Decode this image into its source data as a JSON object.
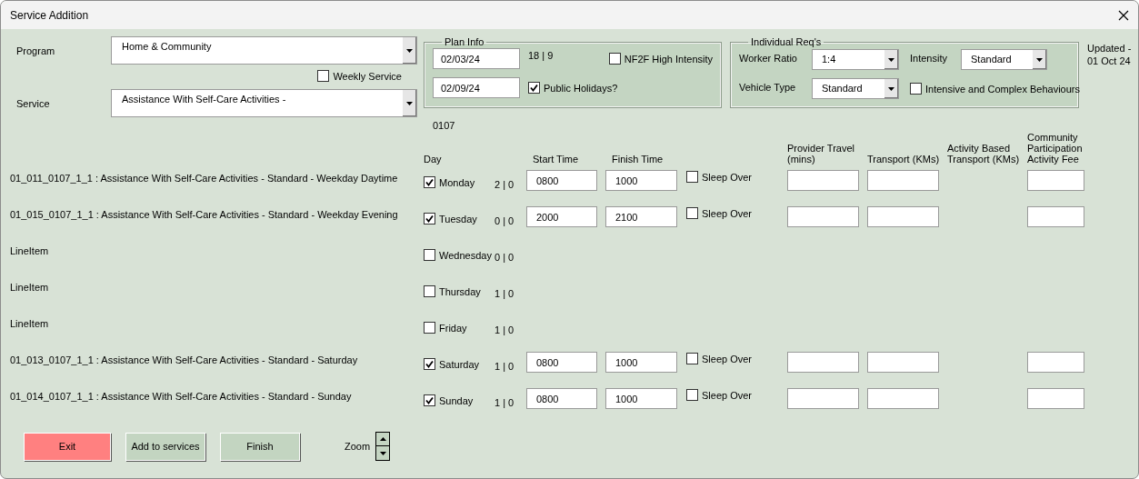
{
  "window": {
    "title": "Service Addition"
  },
  "program": {
    "label": "Program",
    "value": "Home & Community"
  },
  "weekly_service": {
    "label": "Weekly Service",
    "checked": false
  },
  "service": {
    "label": "Service",
    "value": "Assistance With Self-Care Activities -"
  },
  "plan_info": {
    "title": "Plan Info",
    "start_date": "02/03/24",
    "end_date": "02/09/24",
    "counts": "18 | 9",
    "nf2f_high_intensity": {
      "label": "NF2F High Intensity",
      "checked": false
    },
    "public_holidays": {
      "label": "Public Holidays?",
      "checked": true
    }
  },
  "individual_reqs": {
    "title": "Individual Req's",
    "worker_ratio": {
      "label": "Worker Ratio",
      "value": "1:4"
    },
    "intensity": {
      "label": "Intensity",
      "value": "Standard"
    },
    "vehicle_type": {
      "label": "Vehicle Type",
      "value": "Standard"
    },
    "intensive_behaviours": {
      "label": "Intensive and Complex Behaviours",
      "checked": false
    }
  },
  "updated": [
    "Updated -",
    "01 Oct 24"
  ],
  "code": "0107",
  "columns": [
    "Day",
    "Start Time",
    "Finish Time",
    "Provider Travel (mins)",
    "Transport (KMs)",
    "Activity Based Transport (KMs)",
    "Community Participation Activity Fee"
  ],
  "rows": [
    {
      "line_item": "01_011_0107_1_1 : Assistance With Self-Care Activities - Standard - Weekday Daytime",
      "day": "Monday",
      "checked": true,
      "counts": "2 | 0",
      "start": "0800",
      "finish": "1000",
      "sleep_over": {
        "label": "Sleep Over",
        "checked": false
      }
    },
    {
      "line_item": "01_015_0107_1_1 : Assistance With Self-Care Activities - Standard - Weekday Evening",
      "day": "Tuesday",
      "checked": true,
      "counts": "0 | 0",
      "start": "2000",
      "finish": "2100",
      "sleep_over": {
        "label": "Sleep Over",
        "checked": false
      }
    },
    {
      "line_item": "LineItem",
      "day": "Wednesday",
      "checked": false,
      "counts": "0 | 0"
    },
    {
      "line_item": "LineItem",
      "day": "Thursday",
      "checked": false,
      "counts": "1 | 0"
    },
    {
      "line_item": "LineItem",
      "day": "Friday",
      "checked": false,
      "counts": "1 | 0"
    },
    {
      "line_item": "01_013_0107_1_1 : Assistance With Self-Care Activities - Standard - Saturday",
      "day": "Saturday",
      "checked": true,
      "counts": "1 | 0",
      "start": "0800",
      "finish": "1000",
      "sleep_over": {
        "label": "Sleep Over",
        "checked": false
      }
    },
    {
      "line_item": "01_014_0107_1_1 : Assistance With Self-Care Activities - Standard - Sunday",
      "day": "Sunday",
      "checked": true,
      "counts": "1 | 0",
      "start": "0800",
      "finish": "1000",
      "sleep_over": {
        "label": "Sleep Over",
        "checked": false
      }
    }
  ],
  "buttons": [
    {
      "label": "Exit",
      "kind": "danger"
    },
    {
      "label": "Add to services",
      "kind": "normal"
    },
    {
      "label": "Finish",
      "kind": "normal"
    }
  ],
  "zoom": {
    "label": "Zoom"
  }
}
